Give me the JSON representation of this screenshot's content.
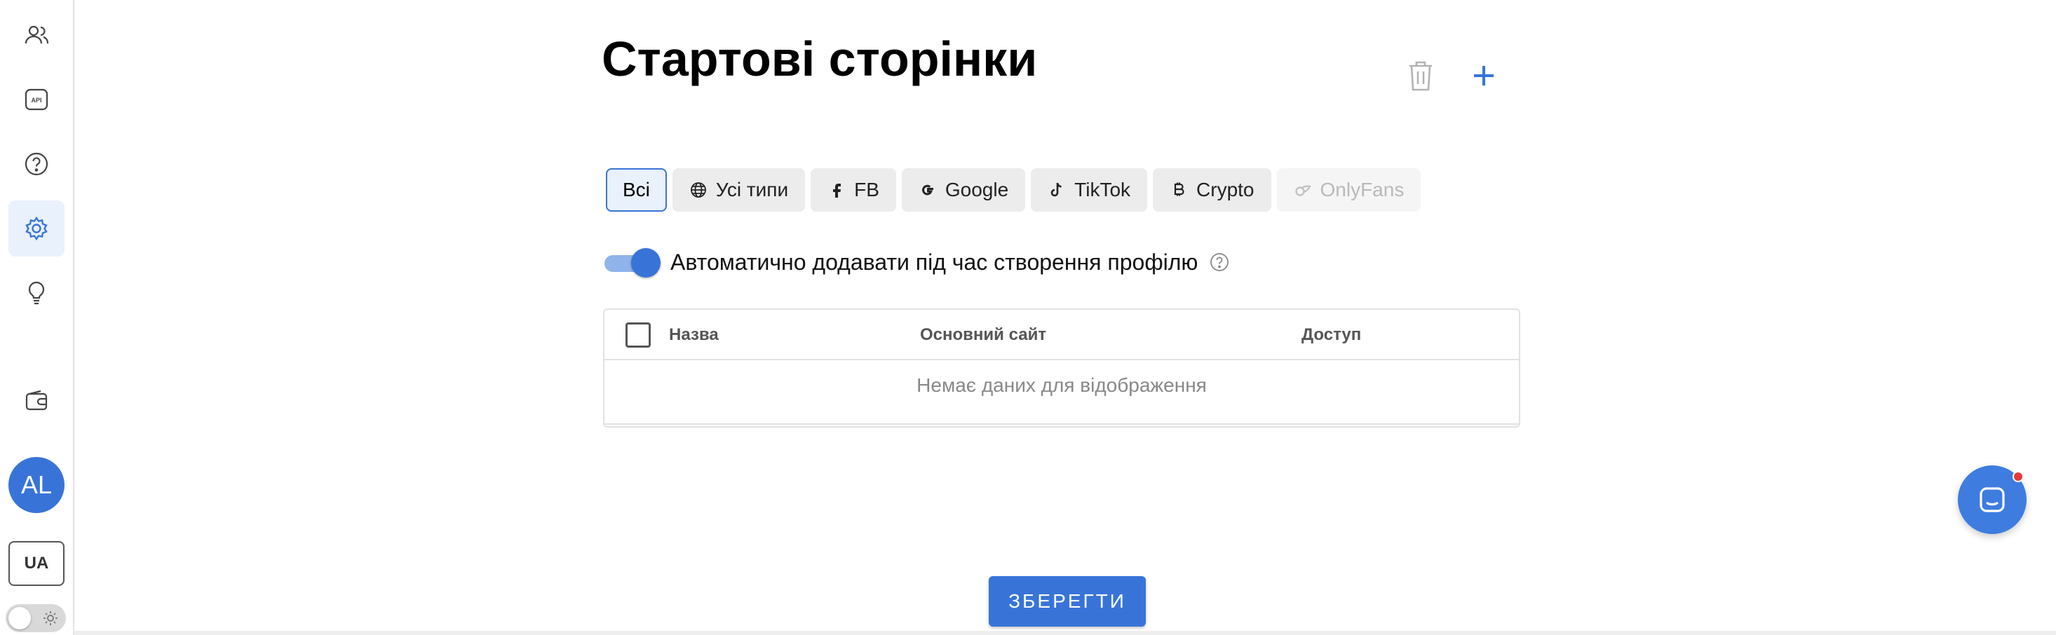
{
  "page": {
    "title": "Стартові сторінки"
  },
  "sidebar": {
    "items": [
      {
        "name": "users",
        "icon": "users-icon"
      },
      {
        "name": "api",
        "icon": "api-icon",
        "label": "API"
      },
      {
        "name": "help",
        "icon": "question-icon"
      },
      {
        "name": "settings",
        "icon": "gear-icon",
        "active": true
      },
      {
        "name": "ideas",
        "icon": "lightbulb-icon"
      },
      {
        "name": "wallet",
        "icon": "wallet-icon"
      }
    ],
    "avatar_initials": "AL",
    "language": "UA",
    "theme_toggle": {
      "mode": "light"
    }
  },
  "filters": {
    "chips": [
      {
        "label": "Всі",
        "icon": "",
        "selected": true,
        "disabled": false
      },
      {
        "label": "Усі типи",
        "icon": "globe-icon",
        "selected": false,
        "disabled": false
      },
      {
        "label": "FB",
        "icon": "facebook-icon",
        "selected": false,
        "disabled": false
      },
      {
        "label": "Google",
        "icon": "google-icon",
        "selected": false,
        "disabled": false
      },
      {
        "label": "TikTok",
        "icon": "tiktok-icon",
        "selected": false,
        "disabled": false
      },
      {
        "label": "Crypto",
        "icon": "bitcoin-icon",
        "selected": false,
        "disabled": false
      },
      {
        "label": "OnlyFans",
        "icon": "onlyfans-icon",
        "selected": false,
        "disabled": true
      }
    ]
  },
  "auto_add": {
    "label": "Автоматично додавати під час створення профілю",
    "enabled": true
  },
  "table": {
    "columns": [
      "Назва",
      "Основний сайт",
      "Доступ"
    ],
    "rows": [],
    "empty_text": "Немає даних для відображення"
  },
  "actions": {
    "save_label": "ЗБЕРЕГТИ"
  },
  "colors": {
    "accent": "#3874d8",
    "chip_bg": "#ececec",
    "selected_bg": "#e9f1fc",
    "notification": "#e53935"
  }
}
